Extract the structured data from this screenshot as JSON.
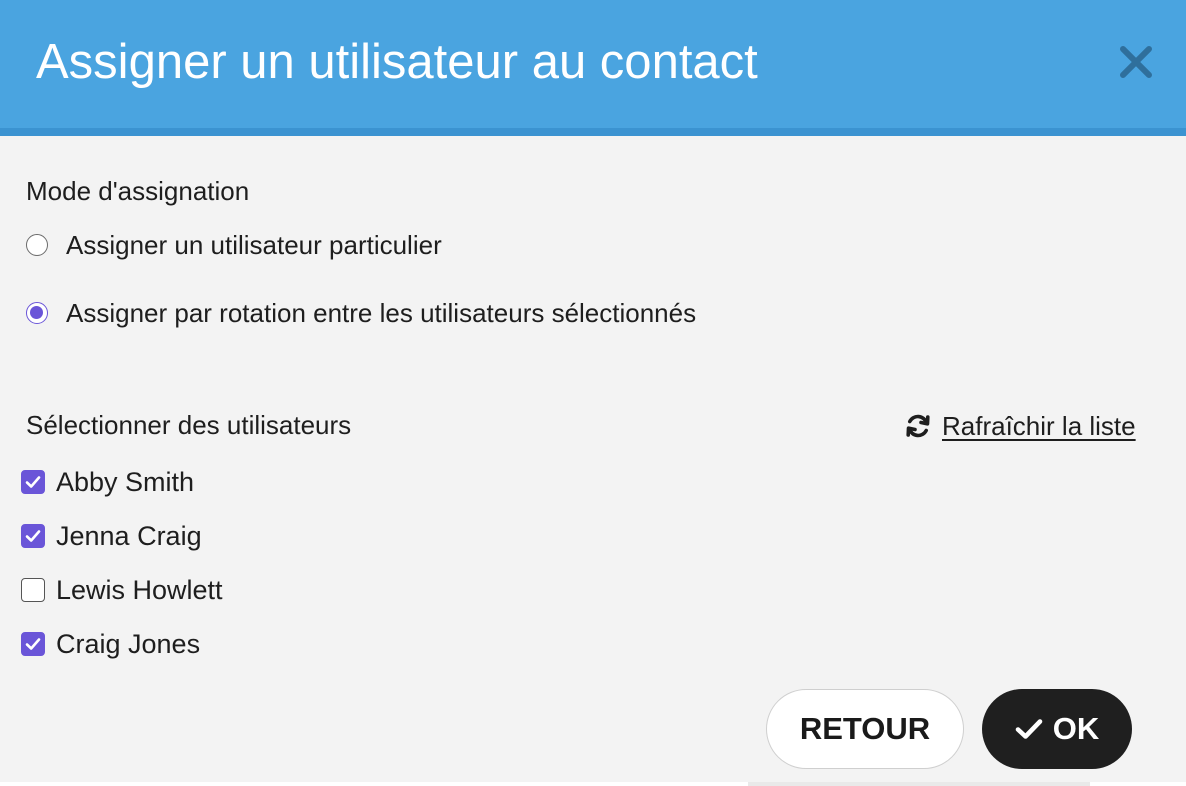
{
  "dialog": {
    "title": "Assigner un utilisateur au contact",
    "close_icon": "close-icon"
  },
  "mode": {
    "label": "Mode d'assignation",
    "options": [
      {
        "label": "Assigner un utilisateur particulier",
        "selected": false
      },
      {
        "label": "Assigner par rotation entre les utilisateurs sélectionnés",
        "selected": true
      }
    ]
  },
  "users": {
    "label": "Sélectionner des utilisateurs",
    "refresh_label": " Rafraîchir la liste",
    "refresh_icon": "refresh-icon",
    "items": [
      {
        "name": "Abby Smith",
        "checked": true
      },
      {
        "name": "Jenna Craig",
        "checked": true
      },
      {
        "name": "Lewis Howlett",
        "checked": false
      },
      {
        "name": "Craig Jones",
        "checked": true
      }
    ]
  },
  "footer": {
    "back_label": "RETOUR",
    "ok_label": "OK",
    "ok_icon": "checkmark-icon"
  },
  "colors": {
    "header": "#4aa4e0",
    "accent": "#6a55d8",
    "ok_button": "#1f1f1f"
  }
}
